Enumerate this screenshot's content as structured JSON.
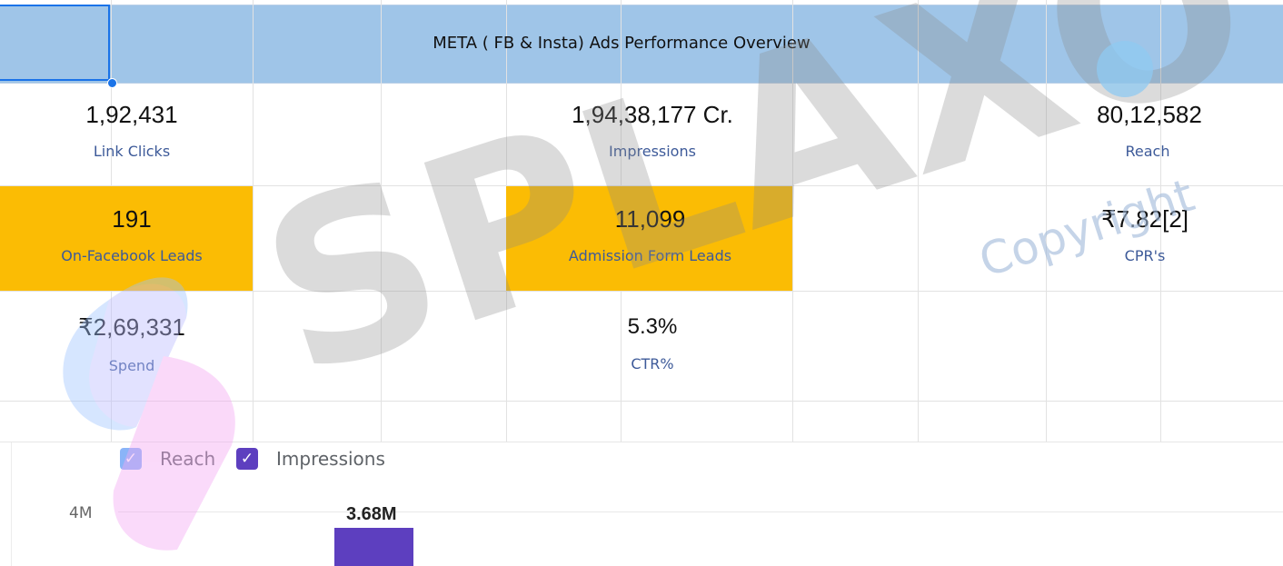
{
  "sheet": {
    "title": "META ( FB & Insta) Ads Performance Overview"
  },
  "metrics": {
    "link_clicks": {
      "value": "1,92,431",
      "label": "Link Clicks"
    },
    "impressions": {
      "value": "1,94,38,177 Cr.",
      "label": "Impressions"
    },
    "reach": {
      "value": "80,12,582",
      "label": "Reach"
    },
    "fb_leads": {
      "value": "191",
      "label": "On-Facebook Leads"
    },
    "admission_leads": {
      "value": "11,099",
      "label": "Admission Form Leads"
    },
    "cpr": {
      "value": "₹7.82[2]",
      "label": "CPR's"
    },
    "spend": {
      "value": "₹2,69,331",
      "label": "Spend"
    },
    "ctr": {
      "value": "5.3%",
      "label": "CTR%"
    }
  },
  "colors": {
    "header_band": "#9fc5e8",
    "highlight": "#fbbc04",
    "label_text": "#3d5a99",
    "reach_series": "#8ab4f8",
    "impressions_series": "#5d3fbf"
  },
  "watermark": {
    "brand": "SPLAXO",
    "copyright": "Copyright"
  },
  "chart_data": {
    "type": "bar",
    "legend": [
      "Reach",
      "Impressions"
    ],
    "legend_position": "top-left",
    "y_ticks": [
      "4M"
    ],
    "series": [
      {
        "name": "Reach",
        "values": []
      },
      {
        "name": "Impressions",
        "values": [
          3.68
        ]
      }
    ],
    "data_labels": [
      "3.68M"
    ],
    "ylim_visible_top": 4,
    "units": "M"
  }
}
